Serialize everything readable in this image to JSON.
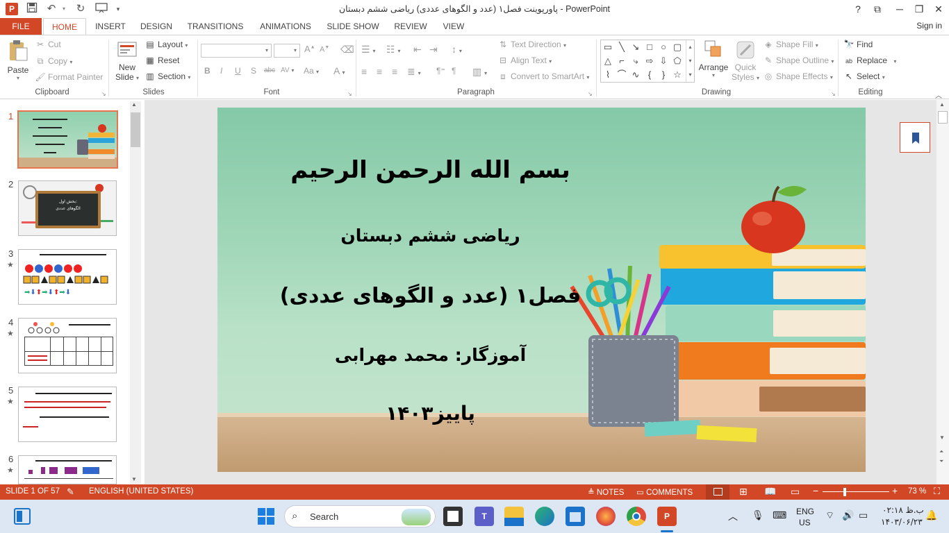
{
  "titlebar": {
    "title": "پاورپوینت فصل۱ (عدد و الگوهای عددی) ریاضی ششم دبستان - PowerPoint",
    "app_icon": "P",
    "help": "?",
    "restore_ribbon": "⧉",
    "minimize": "─",
    "maximize": "❐",
    "close": "✕"
  },
  "tabs": {
    "file": "FILE",
    "items": [
      "HOME",
      "INSERT",
      "DESIGN",
      "TRANSITIONS",
      "ANIMATIONS",
      "SLIDE SHOW",
      "REVIEW",
      "VIEW"
    ],
    "signin": "Sign in"
  },
  "ribbon": {
    "clipboard": {
      "label": "Clipboard",
      "paste": "Paste",
      "cut": "Cut",
      "copy": "Copy",
      "format_painter": "Format Painter"
    },
    "slides": {
      "label": "Slides",
      "new_slide": "New",
      "new_slide2": "Slide",
      "layout": "Layout",
      "reset": "Reset",
      "section": "Section"
    },
    "font": {
      "label": "Font",
      "bold": "B",
      "italic": "I",
      "underline": "U",
      "shadow": "S",
      "strike": "abc",
      "spacing": "AV",
      "case": "Aa",
      "color": "A",
      "grow": "A",
      "shrink": "A"
    },
    "paragraph": {
      "label": "Paragraph",
      "text_direction": "Text Direction",
      "align_text": "Align Text",
      "convert_smartart": "Convert to SmartArt"
    },
    "drawing": {
      "label": "Drawing",
      "arrange": "Arrange",
      "quick_styles": "Quick",
      "quick_styles2": "Styles",
      "shape_fill": "Shape Fill",
      "shape_outline": "Shape Outline",
      "shape_effects": "Shape Effects"
    },
    "editing": {
      "label": "Editing",
      "find": "Find",
      "replace": "Replace",
      "select": "Select"
    }
  },
  "slides_pane": {
    "slides": [
      {
        "num": "1",
        "star": ""
      },
      {
        "num": "2",
        "star": ""
      },
      {
        "num": "3",
        "star": "★"
      },
      {
        "num": "4",
        "star": "★"
      },
      {
        "num": "5",
        "star": "★"
      },
      {
        "num": "6",
        "star": "★"
      }
    ],
    "thumb2_text": "بخش اول:",
    "thumb2_text2": "الگوهای عددی"
  },
  "slide": {
    "line1": "بسم الله الرحمن الرحیم",
    "line2": "ریاضی ششم دبستان",
    "line3": "فصل۱ (عدد و الگوهای عددی)",
    "line4": "آموزگار: محمد مهرابی",
    "line5": "پاییز۱۴۰۳"
  },
  "statusbar": {
    "slide_info": "SLIDE 1 OF 57",
    "language": "ENGLISH (UNITED STATES)",
    "notes": "NOTES",
    "comments": "COMMENTS",
    "zoom_minus": "−",
    "zoom_plus": "+",
    "zoom": "73 %"
  },
  "taskbar": {
    "search": "Search",
    "lang1": "ENG",
    "lang2": "US",
    "time": "۰۲:۱۸ ب.ظ",
    "date": "۱۴۰۳/۰۶/۲۳"
  },
  "colors": {
    "accent": "#d24726",
    "slide_bg": "#9fd6b7",
    "taskbar": "#dde6f3"
  }
}
